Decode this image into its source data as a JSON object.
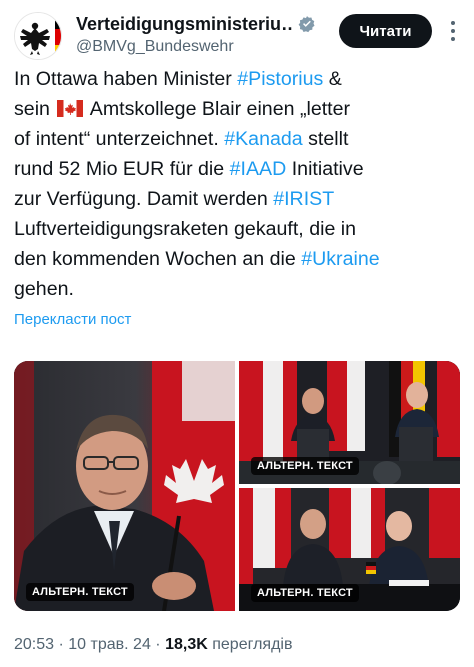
{
  "header": {
    "display_name": "Verteidigungsministeriu…",
    "handle": "@BMVg_Bundeswehr",
    "read_button": "Читати"
  },
  "tweet": {
    "lines": [
      [
        "In Ottawa haben Minister ",
        {
          "tag": "#Pistorius"
        },
        " &"
      ],
      [
        "sein ",
        {
          "flag": "canada-flag"
        },
        " Amtskollege Blair einen „letter"
      ],
      [
        "of intent“ unterzeichnet. ",
        {
          "tag": "#Kanada"
        },
        " stellt"
      ],
      [
        "rund 52 Mio EUR für die ",
        {
          "tag": "#IAAD"
        },
        " Initiative"
      ],
      [
        "zur Verfügung. Damit werden ",
        {
          "tag": "#IRIST"
        }
      ],
      [
        "Luftverteidigungsraketen gekauft, die in"
      ],
      [
        "den kommenden Wochen an die ",
        {
          "tag": "#Ukraine"
        }
      ],
      [
        "gehen."
      ]
    ],
    "translate_link": "Перекласти пост"
  },
  "media": {
    "alt_badge": "АЛЬТЕРН. ТЕКСТ"
  },
  "meta": {
    "time": "20:53",
    "date": "10 трав. 24",
    "views_count": "18,3K",
    "views_label": "переглядів"
  },
  "colors": {
    "link": "#1d9bf0",
    "text": "#0f1419",
    "secondary": "#536471",
    "canada_red": "#d52b1e",
    "german_gold": "#ffcc00"
  }
}
